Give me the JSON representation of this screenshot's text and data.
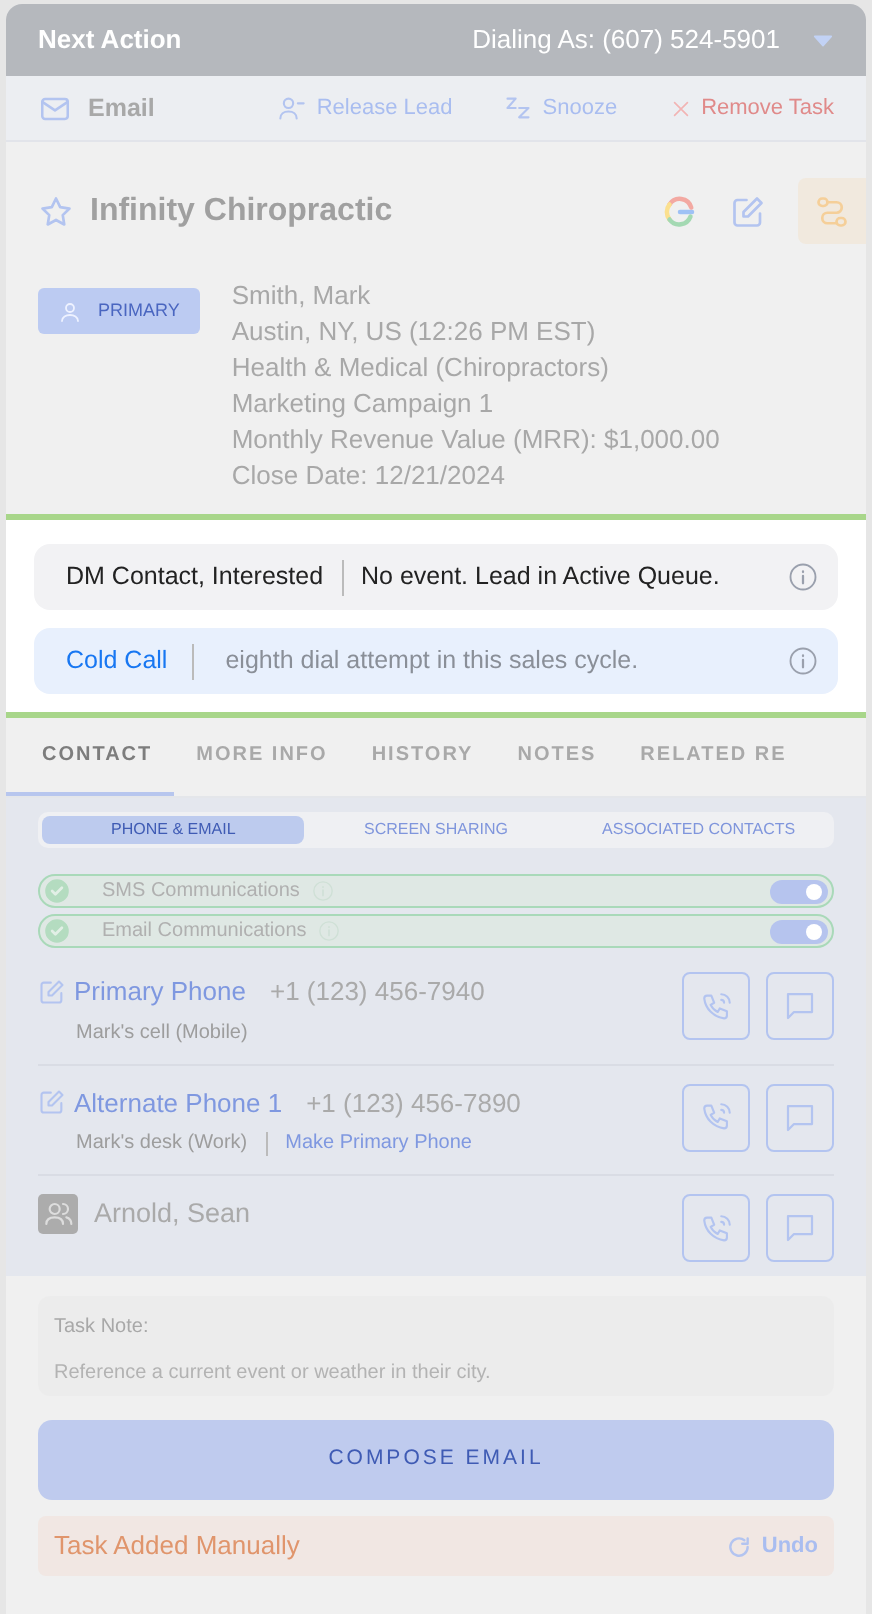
{
  "header": {
    "title": "Next Action",
    "dialing_as": "Dialing As: (607) 524-5901"
  },
  "toolbar": {
    "task_type": "Email",
    "actions": [
      {
        "kind": "release",
        "label": "Release Lead"
      },
      {
        "kind": "snooze",
        "label": "Snooze"
      },
      {
        "kind": "remove",
        "label": "Remove Task"
      }
    ]
  },
  "company": {
    "name": "Infinity Chiropractic",
    "badge": "PRIMARY",
    "details": [
      "Smith, Mark",
      "Austin, NY, US (12:26 PM EST)",
      "Health & Medical (Chiropractors)",
      "Marketing Campaign 1",
      "Monthly Revenue Value (MRR): $1,000.00",
      "Close Date: 12/21/2024"
    ]
  },
  "status": {
    "disposition": "DM Contact, Interested",
    "event": "No event. Lead in Active Queue.",
    "call_type": "Cold Call",
    "attempt": "eighth dial attempt in this sales cycle."
  },
  "tabs": [
    {
      "label": "CONTACT",
      "selected": true
    },
    {
      "label": "MORE INFO",
      "selected": false
    },
    {
      "label": "HISTORY",
      "selected": false
    },
    {
      "label": "NOTES",
      "selected": false
    },
    {
      "label": "RELATED RE",
      "selected": false
    }
  ],
  "subtabs": [
    {
      "label": "PHONE & EMAIL",
      "selected": true
    },
    {
      "label": "SCREEN SHARING",
      "selected": false
    },
    {
      "label": "ASSOCIATED CONTACTS",
      "selected": false
    }
  ],
  "communications": [
    {
      "label": "SMS Communications",
      "on": true
    },
    {
      "label": "Email Communications",
      "on": true
    }
  ],
  "contacts": [
    {
      "kind": "phone",
      "label": "Primary Phone",
      "number": "+1 (123) 456-7940",
      "note": "Mark's cell (Mobile)"
    },
    {
      "kind": "phone",
      "label": "Alternate Phone 1",
      "number": "+1 (123) 456-7890",
      "note": "Mark's desk (Work)",
      "link": "Make Primary Phone"
    },
    {
      "kind": "person",
      "name": "Arnold, Sean"
    }
  ],
  "task_note": {
    "label": "Task Note:",
    "text": "Reference a current event or weather in their city."
  },
  "compose_button": "COMPOSE EMAIL",
  "banner": {
    "text": "Task Added Manually",
    "undo": "Undo"
  }
}
